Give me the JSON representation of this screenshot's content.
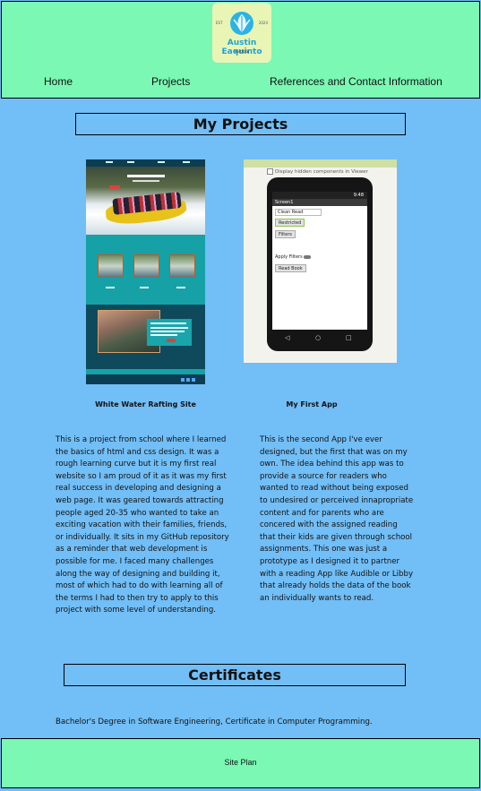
{
  "header": {
    "logo": {
      "name": "Austin Eaquinto",
      "subtitle": "Portfolio",
      "year_left": "EST",
      "year_right": "2024",
      "icon": "leaf-badge-icon"
    },
    "nav": [
      {
        "label": "Home"
      },
      {
        "label": "Projects"
      },
      {
        "label": "References and Contact Information"
      }
    ]
  },
  "projects": {
    "title": "My Projects",
    "items": [
      {
        "caption": "White Water Rafting Site",
        "description": "This is a project from school where I learned the basics of html and css design. It was a rough learning curve but it is my first real website so I am proud of it as it was my first real success in developing and designing a web page. It was geared towards attracting people aged 20-35 who wanted to take an exciting vacation with their families, friends, or individually. It sits in my GitHub repository as a reminder that web development is possible for me. I faced many challenges along the way of designing and building it, most of which had to do with learning all of the terms I had to then try to apply to this project with some level of understanding."
      },
      {
        "caption": "My First App",
        "description": "This is the second App I've ever designed, but the first that was on my own. The idea behind this app was to provide a source for readers who wanted to read without being exposed to undesired or perceived innapropriate content and for parents who are concered with the assigned reading that their kids are given through school assignments. This one was just a prototype as I designed it to partner with a reading App like Audible or Libby that already holds the data of the book an individually wants to read.",
        "screenshot": {
          "checkbox_label": "Display hidden components in Viewer",
          "screen_title": "Screen1",
          "time": "9:48",
          "textbox_value": "Clean Read",
          "buttons": [
            "Restricted",
            "Filters",
            "Read Book"
          ],
          "switch_label": "Apply Filters"
        }
      }
    ]
  },
  "certificates": {
    "title": "Certificates",
    "text": "Bachelor's Degree in Software Engineering, Certificate in Computer Programming."
  },
  "footer": {
    "link": "Site Plan"
  },
  "colors": {
    "background": "#72bef6",
    "header_footer": "#7af8b4",
    "logo_bg": "#e9f5b5",
    "logo_text": "#1ca3d8"
  }
}
